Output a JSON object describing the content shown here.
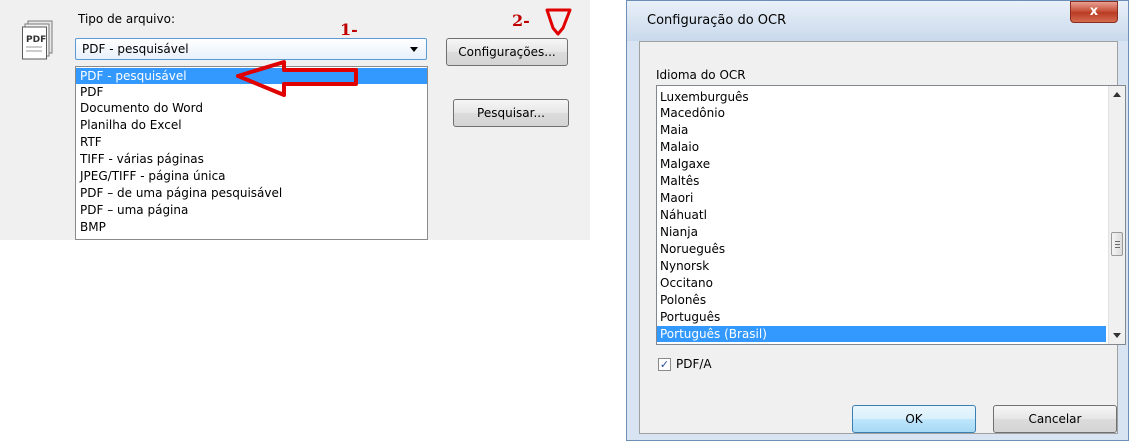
{
  "left_panel": {
    "file_type_label": "Tipo de arquivo:",
    "selected_type": "PDF - pesquisável",
    "dropdown_options": [
      "PDF - pesquisável",
      "PDF",
      "Documento do Word",
      "Planilha do Excel",
      "RTF",
      "TIFF - várias páginas",
      "JPEG/TIFF - página única",
      "PDF – de uma página pesquisável",
      "PDF – uma página",
      "BMP"
    ],
    "highlighted_option_index": 0,
    "config_button": "Configurações...",
    "search_button": "Pesquisar...",
    "file_icon_text": "PDF",
    "annotation_1": "1-",
    "annotation_2": "2-"
  },
  "dialog": {
    "title": "Configuração do OCR",
    "close_glyph": "x",
    "language_label": "Idioma do OCR",
    "languages": [
      "Luxemburguês",
      "Macedônio",
      "Maia",
      "Malaio",
      "Malgaxe",
      "Maltês",
      "Maori",
      "Náhuatl",
      "Nianja",
      "Norueguês",
      "Nynorsk",
      "Occitano",
      "Polonês",
      "Português",
      "Português (Brasil)"
    ],
    "selected_language_index": 14,
    "pdfa_label": "PDF/A",
    "pdfa_checked": true,
    "checkmark_glyph": "✓",
    "ok_button": "OK",
    "cancel_button": "Cancelar"
  },
  "colors": {
    "selection": "#3399ff",
    "annotation_red": "#e00000",
    "annotation_note": "#c00000"
  },
  "icons": [
    "pdf-file-icon",
    "dropdown-arrow-icon",
    "scroll-up-icon",
    "scroll-down-icon",
    "close-icon",
    "checkmark-icon",
    "arrow-annotation-icon"
  ]
}
